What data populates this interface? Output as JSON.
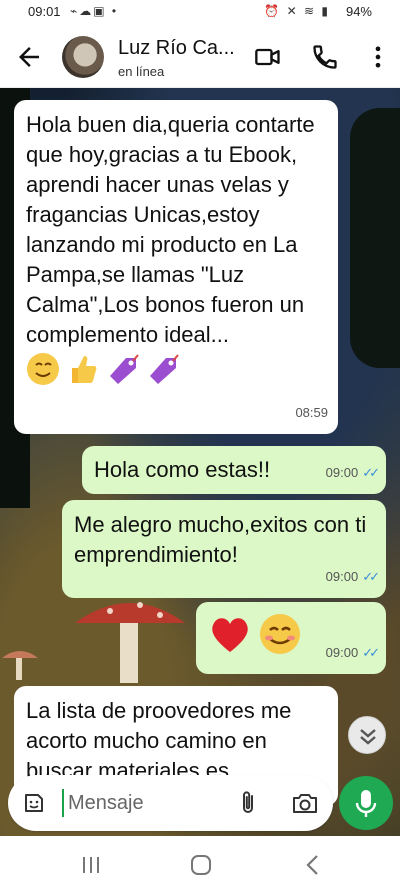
{
  "status_bar": {
    "time": "09:01",
    "battery": "94%"
  },
  "header": {
    "contact_name": "Luz Río Ca...",
    "status": "en línea"
  },
  "messages": [
    {
      "direction": "incoming",
      "text": "Hola buen dia,queria contarte que hoy,gracias a tu Ebook, aprendi hacer unas velas y fragancias Unicas,estoy lanzando mi producto en La Pampa,se llamas \"Luz Calma\",Los bonos fueron un complemento ideal...",
      "emojis": [
        "smiling-face-icon",
        "thumbs-up-icon",
        "label-tag-icon",
        "label-tag-icon"
      ],
      "time": "08:59"
    },
    {
      "direction": "outgoing",
      "text": "Hola como estas!!",
      "time": "09:00",
      "read": true
    },
    {
      "direction": "outgoing",
      "text": "Me alegro mucho,exitos con ti emprendimiento!",
      "time": "09:00",
      "read": true
    },
    {
      "direction": "outgoing",
      "text": "",
      "emojis": [
        "red-heart-icon",
        "smiling-face-icon"
      ],
      "time": "09:00",
      "read": true
    },
    {
      "direction": "incoming",
      "text": "La lista de proovedores me acorto mucho camino en buscar materiales es"
    }
  ],
  "composer": {
    "placeholder": "Mensaje"
  },
  "colors": {
    "incoming_bubble": "#ffffff",
    "outgoing_bubble": "#dcf8c6",
    "read_ticks": "#3a8ed8",
    "mic_button": "#1ea952"
  }
}
